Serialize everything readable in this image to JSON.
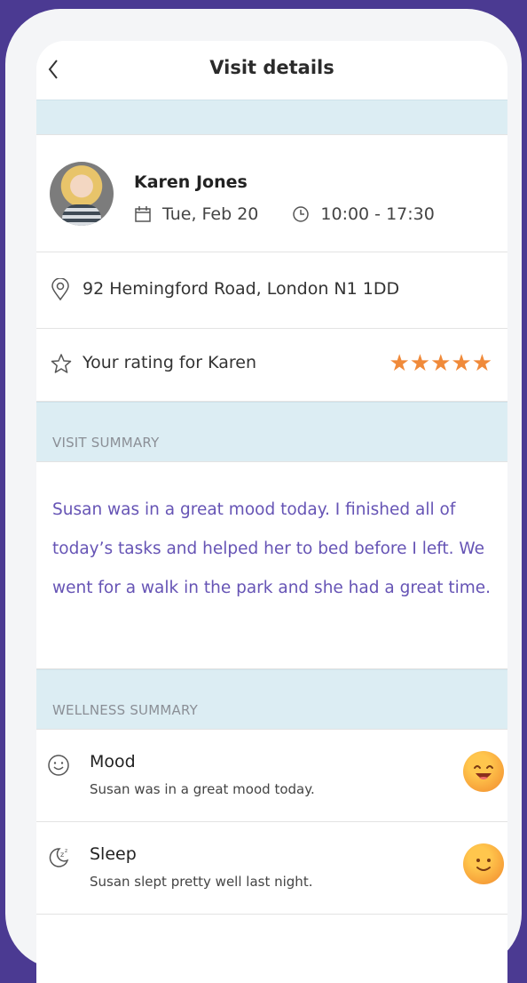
{
  "header": {
    "back_glyph": "‹",
    "title": "Visit details"
  },
  "carer": {
    "name": "Karen Jones",
    "date": "Tue, Feb 20",
    "time": "10:00 - 17:30"
  },
  "address": {
    "text": "92 Hemingford Road, London N1 1DD"
  },
  "rating": {
    "label": "Your rating for Karen",
    "stars": 5,
    "stars_glyphs": "★★★★★"
  },
  "visit_summary": {
    "heading": "VISIT SUMMARY",
    "text": "Susan was in a great mood today. I finished all of today’s tasks and helped her to bed before I left. We went for a walk in the park and she had a great time."
  },
  "wellness": {
    "heading": "WELLNESS SUMMARY",
    "items": [
      {
        "label": "Mood",
        "description": "Susan was in a great mood today.",
        "icon": "smiley-outline-icon",
        "face": "laughing-face-icon"
      },
      {
        "label": "Sleep",
        "description": "Susan slept pretty well last night.",
        "icon": "sleep-moon-icon",
        "face": "smiling-face-icon"
      }
    ]
  },
  "colors": {
    "background": "#4b3a92",
    "section_band": "#dcedf3",
    "summary_text": "#6654b5",
    "stars": "#f08a3a"
  }
}
